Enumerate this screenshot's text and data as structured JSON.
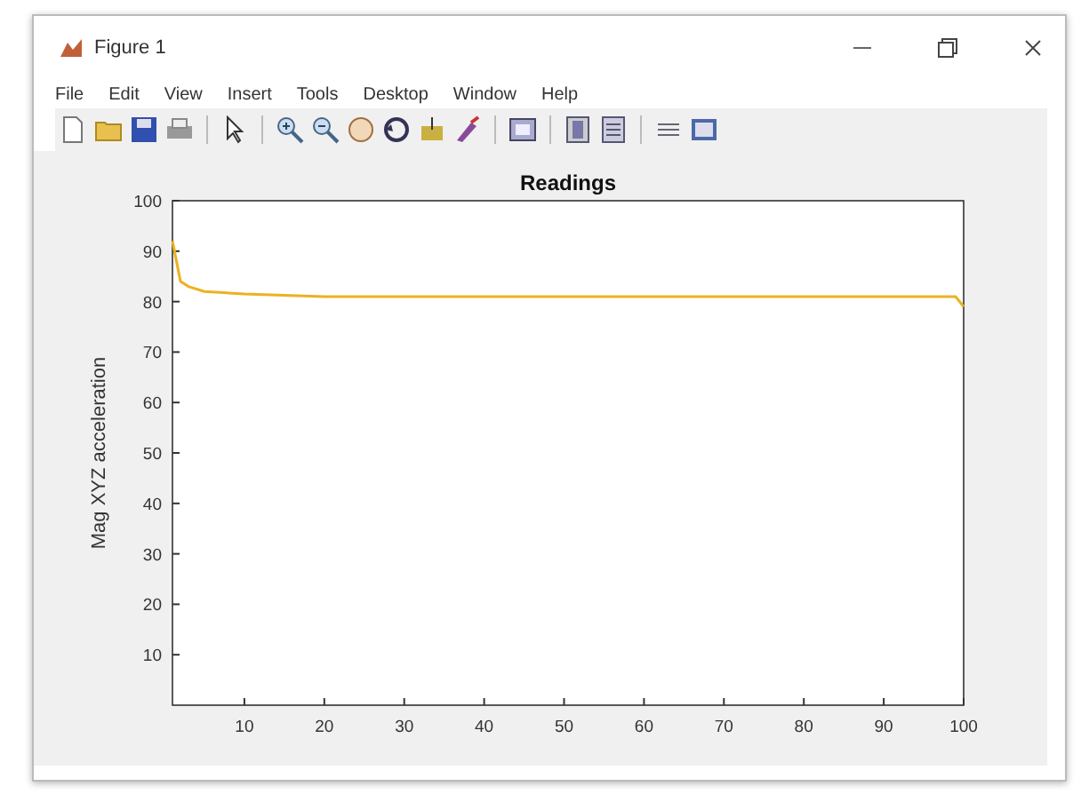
{
  "window": {
    "title": "Figure 1"
  },
  "menu": [
    "File",
    "Edit",
    "View",
    "Insert",
    "Tools",
    "Desktop",
    "Window",
    "Help"
  ],
  "figure": {
    "chart_data": {
      "type": "line",
      "title": "Readings",
      "ylabel": "Mag XYZ acceleration",
      "xlim": [
        1,
        100
      ],
      "ylim": [
        0,
        100
      ],
      "xticks": [
        10,
        20,
        30,
        40,
        50,
        60,
        70,
        80,
        90,
        100
      ],
      "yticks": [
        10,
        20,
        30,
        40,
        50,
        60,
        70,
        80,
        90,
        100
      ],
      "x": [
        1,
        2,
        3,
        5,
        10,
        20,
        30,
        40,
        50,
        60,
        70,
        80,
        90,
        99,
        100
      ],
      "series": [
        {
          "color": "#edb120",
          "values": [
            92,
            84,
            83,
            82,
            81.5,
            81,
            81,
            81,
            81,
            81,
            81,
            81,
            81,
            81,
            79
          ]
        }
      ]
    }
  }
}
